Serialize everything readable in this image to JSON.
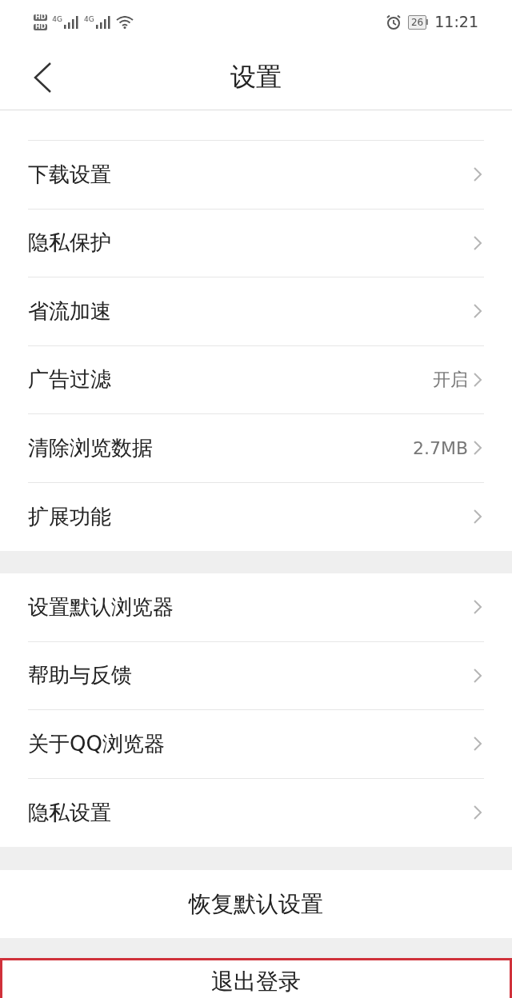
{
  "status_bar": {
    "sims": [
      "HD",
      "HD"
    ],
    "networks": [
      "4G",
      "4G"
    ],
    "battery": "26",
    "time": "11:21"
  },
  "header": {
    "title": "设置"
  },
  "groups": [
    {
      "items": [
        {
          "label": "下载设置"
        },
        {
          "label": "隐私保护"
        },
        {
          "label": "省流加速"
        },
        {
          "label": "广告过滤",
          "value": "开启"
        },
        {
          "label": "清除浏览数据",
          "value": "2.7MB"
        },
        {
          "label": "扩展功能"
        }
      ]
    },
    {
      "items": [
        {
          "label": "设置默认浏览器"
        },
        {
          "label": "帮助与反馈"
        },
        {
          "label": "关于QQ浏览器"
        },
        {
          "label": "隐私设置"
        }
      ]
    }
  ],
  "buttons": [
    {
      "label": "恢复默认设置",
      "highlighted": false
    },
    {
      "label": "退出登录",
      "highlighted": true
    }
  ]
}
